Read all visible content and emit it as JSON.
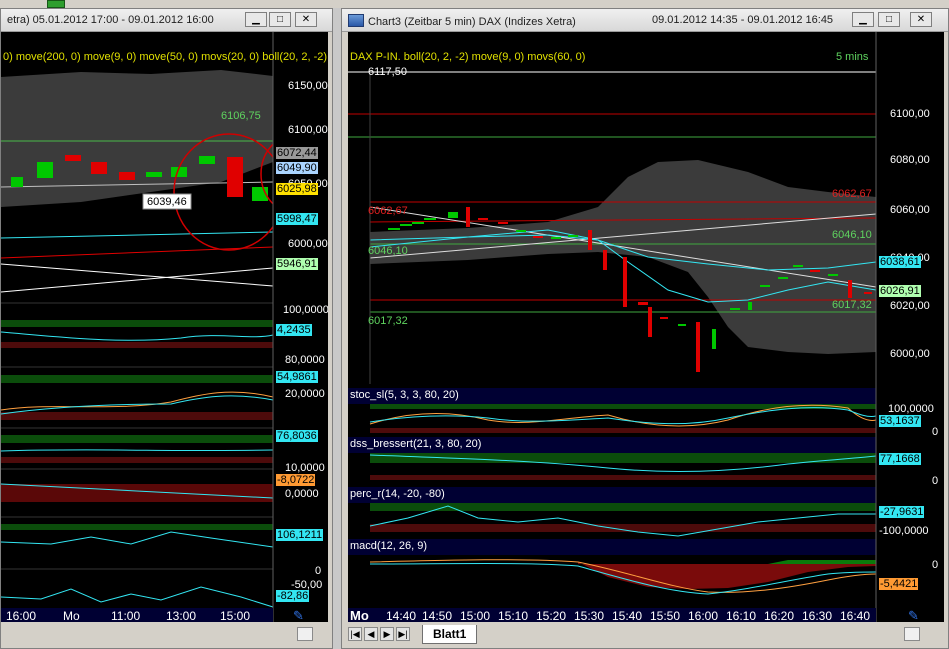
{
  "left_window": {
    "title": "etra) 05.01.2012 17:00 - 09.01.2012 16:00",
    "indicator_line": "0) move(200, 0) move(9, 0) move(50, 0) movs(20, 0) boll(20, 2, -2)",
    "price_axis": [
      "6150,00",
      "6100,00",
      "6050,00",
      "6000,00"
    ],
    "price_labels": [
      "6106,75",
      "6072,44",
      "6049,90",
      "6025,98",
      "5998,47",
      "5946,91"
    ],
    "tooltip": "6039,46",
    "panels": [
      {
        "axis": [
          "100,0000"
        ],
        "value": "4,2435"
      },
      {
        "axis": [
          "80,0000",
          "20,0000"
        ],
        "value": "54,9861"
      },
      {
        "axis": [],
        "value": "76,8036"
      },
      {
        "axis": [
          "10,0000",
          "0,0000"
        ],
        "value": "-8,0722"
      },
      {
        "axis": [],
        "value": "106,1211"
      },
      {
        "axis": [
          "0",
          "-50,00"
        ],
        "value": "-82,86"
      }
    ],
    "time_axis": [
      "16:00",
      "Mo",
      "11:00",
      "13:00",
      "15:00"
    ]
  },
  "right_window": {
    "title": "Chart3 (Zeitbar 5 min)  DAX (Indizes Xetra)",
    "date_range": "09.01.2012 14:35 - 09.01.2012 16:45",
    "indicator_line": "DAX P-IN. boll(20, 2, -2) move(9, 0) movs(60, 0)",
    "interval": "5 mins",
    "price_axis": [
      "6100,00",
      "6080,00",
      "6060,00",
      "6040,00",
      "6020,00",
      "6000,00"
    ],
    "top_price": "6117,50",
    "level_labels": [
      "6062,67",
      "6046,10",
      "6017,32"
    ],
    "left_level_labels": [
      "6062,67",
      "6046,10",
      "6017,32"
    ],
    "right_labels": [
      "6038,61",
      "6026,91"
    ],
    "panels": [
      {
        "name": "stoc_sl(5, 3, 3, 80, 20)",
        "axis": [
          "100,0000",
          "0"
        ],
        "value": "53,1637"
      },
      {
        "name": "dss_bressert(21, 3, 80, 20)",
        "axis": [
          "100,0000",
          "0"
        ],
        "value": "77,1668"
      },
      {
        "name": "perc_r(14, -20, -80)",
        "axis": [
          "0,0000",
          "-100,0000"
        ],
        "value": "-27,9631"
      },
      {
        "name": "macd(12, 26, 9)",
        "axis": [
          "0",
          "-50,00"
        ],
        "value": "-5,4421"
      }
    ],
    "time_axis": [
      "Mo",
      "14:40",
      "14:50",
      "15:00",
      "15:10",
      "15:20",
      "15:30",
      "15:40",
      "15:50",
      "16:00",
      "16:10",
      "16:20",
      "16:30",
      "16:40"
    ],
    "sheet_tab": "Blatt1"
  },
  "colors": {
    "background": "#000000",
    "bull": "#00c800",
    "bear": "#e00000",
    "grid_band_green": "#0b4d0b",
    "grid_band_red": "#4d0b0b",
    "cyan": "#33e6f2",
    "axis_bg": "#000000"
  },
  "icons": {
    "chart": "chart-icon",
    "minimize": "minimize-icon",
    "maximize": "maximize-icon",
    "close": "close-icon",
    "pen": "pen-icon"
  }
}
